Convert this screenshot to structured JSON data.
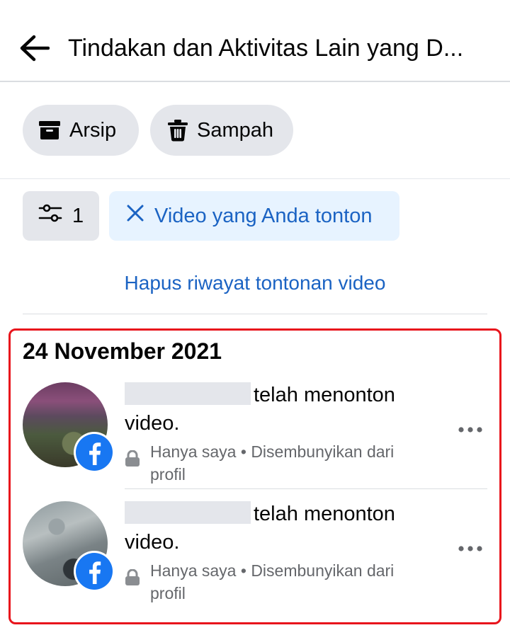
{
  "header": {
    "title": "Tindakan dan Aktivitas Lain yang D..."
  },
  "buttons": {
    "archive_label": "Arsip",
    "trash_label": "Sampah"
  },
  "filter": {
    "count": "1",
    "active_chip": "Video yang Anda tonton"
  },
  "clear_link": "Hapus riwayat tontonan video",
  "section": {
    "date": "24 November 2021",
    "items": [
      {
        "action": "telah menonton",
        "object": "video.",
        "privacy": "Hanya saya",
        "separator": "•",
        "status": "Disembunyikan dari profil"
      },
      {
        "action": "telah menonton",
        "object": "video.",
        "privacy": "Hanya saya",
        "separator": "•",
        "status": "Disembunyikan dari profil"
      }
    ]
  },
  "colors": {
    "accent_blue": "#1b63c3",
    "chip_bg": "#e7f3ff",
    "pill_bg": "#e4e6eb",
    "highlight_red": "#e8141c",
    "facebook_blue": "#1877f2"
  },
  "icons": [
    "back-arrow-icon",
    "archive-icon",
    "trash-icon",
    "filter-sliders-icon",
    "close-icon",
    "facebook-icon",
    "lock-icon",
    "more-icon"
  ]
}
